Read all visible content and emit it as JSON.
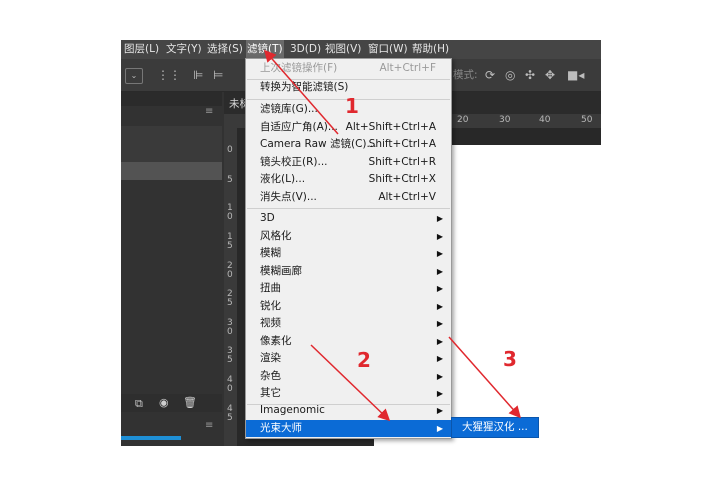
{
  "menubar": [
    {
      "label": "图层(L)",
      "active": false
    },
    {
      "label": "文字(Y)",
      "active": false
    },
    {
      "label": "选择(S)",
      "active": false
    },
    {
      "label": "滤镜(T)",
      "active": true
    },
    {
      "label": "3D(D)",
      "active": false
    },
    {
      "label": "视图(V)",
      "active": false
    },
    {
      "label": "窗口(W)",
      "active": false
    },
    {
      "label": "帮助(H)",
      "active": false
    }
  ],
  "options_bar": {
    "mode_label": "模式:",
    "icons": [
      "chevron-down-icon",
      "transform-controls-icon",
      "align-left-icon",
      "align-center-icon",
      "orbit-3d-icon",
      "roll-3d-icon",
      "pan-3d-icon",
      "slide-3d-icon",
      "camera-3d-icon"
    ]
  },
  "document_tab": {
    "title": "未标"
  },
  "ruler_top_ticks": [
    "20",
    "30",
    "40",
    "50"
  ],
  "ruler_left_ticks": [
    "0",
    "5",
    "1\n0",
    "1\n5",
    "2\n0",
    "2\n5",
    "3\n0",
    "3\n5",
    "4\n0",
    "4\n5"
  ],
  "left_panel": {
    "bottom_icons": [
      "new-layer-icon",
      "camera-icon",
      "trash-icon"
    ]
  },
  "filter_menu": {
    "group1": [
      {
        "label": "上次滤镜操作(F)",
        "shortcut": "Alt+Ctrl+F",
        "disabled": true
      }
    ],
    "group2": [
      {
        "label": "转换为智能滤镜(S)",
        "shortcut": "",
        "disabled": false
      }
    ],
    "group3": [
      {
        "label": "滤镜库(G)...",
        "shortcut": ""
      },
      {
        "label": "自适应广角(A)...",
        "shortcut": "Alt+Shift+Ctrl+A"
      },
      {
        "label": "Camera Raw 滤镜(C)...",
        "shortcut": "Shift+Ctrl+A"
      },
      {
        "label": "镜头校正(R)...",
        "shortcut": "Shift+Ctrl+R"
      },
      {
        "label": "液化(L)...",
        "shortcut": "Shift+Ctrl+X"
      },
      {
        "label": "消失点(V)...",
        "shortcut": "Alt+Ctrl+V"
      }
    ],
    "group4": [
      {
        "label": "3D"
      },
      {
        "label": "风格化"
      },
      {
        "label": "模糊"
      },
      {
        "label": "模糊画廊"
      },
      {
        "label": "扭曲"
      },
      {
        "label": "锐化"
      },
      {
        "label": "视频"
      },
      {
        "label": "像素化"
      },
      {
        "label": "渲染"
      },
      {
        "label": "杂色"
      },
      {
        "label": "其它"
      }
    ],
    "group5": [
      {
        "label": "Imagenomic",
        "highlighted": false
      },
      {
        "label": "光束大师",
        "highlighted": true
      }
    ]
  },
  "submenu": {
    "label": "大猩猩汉化 ..."
  },
  "annotations": {
    "color": "#e0282e",
    "steps": [
      "1",
      "2",
      "3"
    ]
  }
}
